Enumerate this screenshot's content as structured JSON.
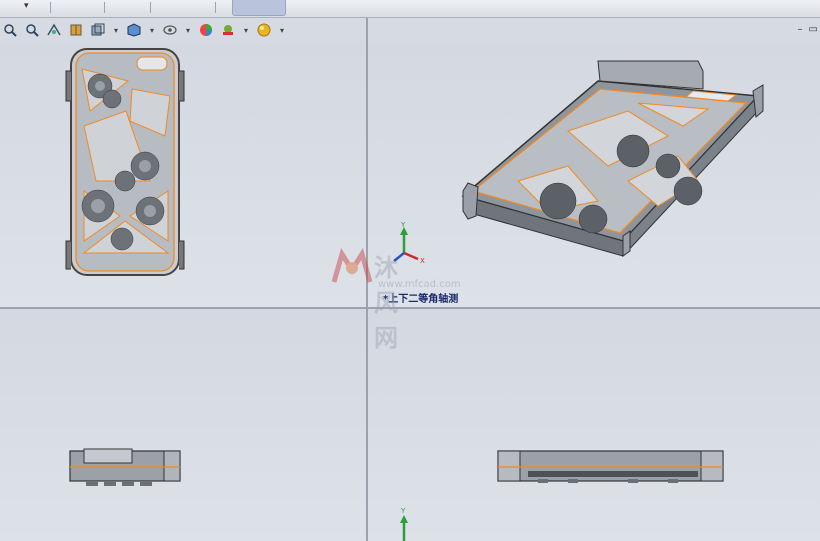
{
  "toolbar": {
    "icons": [
      "zoom-to-fit-icon",
      "zoom-area-icon",
      "previous-view-icon",
      "section-view-icon",
      "view-orientation-icon",
      "display-style-icon",
      "hide-show-items-icon",
      "edit-appearance-icon",
      "apply-scene-icon",
      "view-settings-icon"
    ],
    "dropdown_glyph": "▾"
  },
  "viewport": {
    "label": "*上下二等角轴测",
    "triad_y": "Y",
    "triad_x": "X"
  },
  "watermark": {
    "cn": "沐风网",
    "url": "www.mfcad.com"
  },
  "colors": {
    "edge_highlight": "#f08a24",
    "part_gray": "#9aa0a8",
    "triad_green": "#2e9e3a",
    "triad_red": "#d0282a"
  }
}
